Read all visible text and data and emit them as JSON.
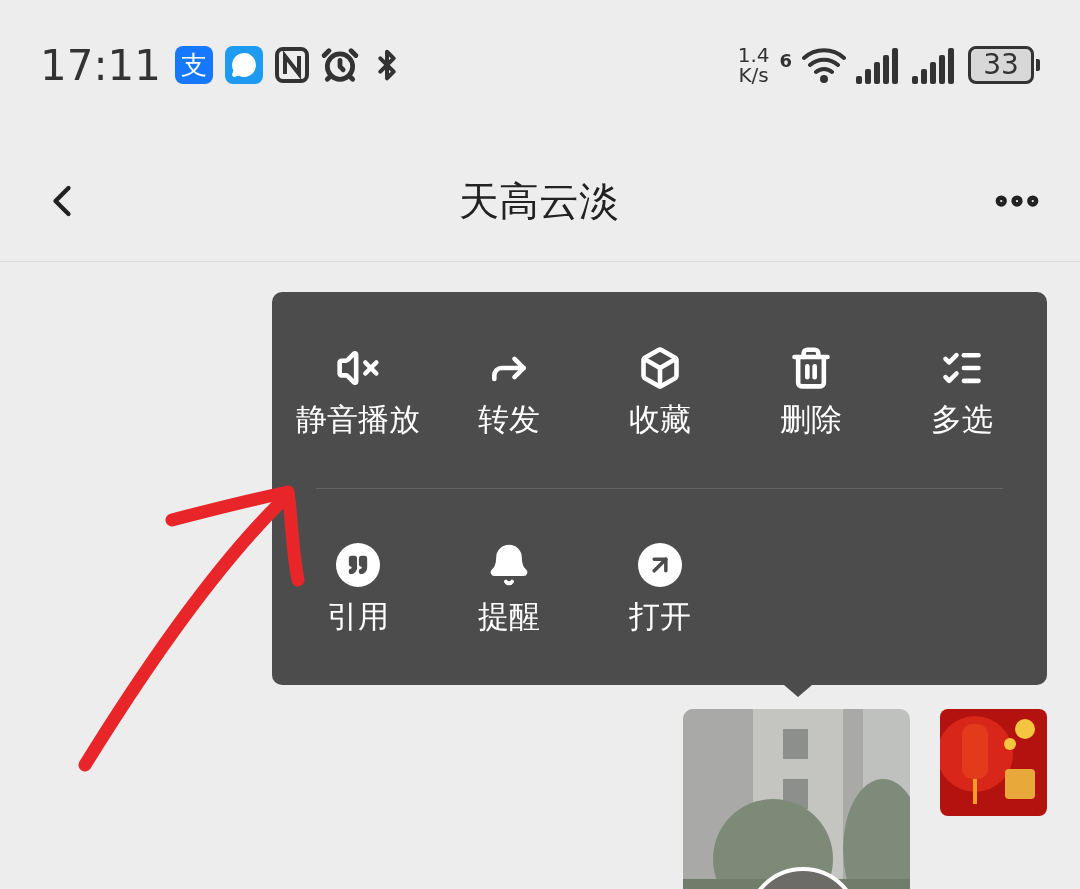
{
  "status_bar": {
    "time": "17:11",
    "app_badge": "支",
    "net_speed": "1.4",
    "net_unit": "K/s",
    "wifi_label": "6",
    "battery": "33"
  },
  "header": {
    "title": "天高云淡"
  },
  "context_menu": {
    "rows": [
      [
        "静音播放",
        "转发",
        "收藏",
        "删除",
        "多选"
      ],
      [
        "引用",
        "提醒",
        "打开"
      ]
    ]
  }
}
